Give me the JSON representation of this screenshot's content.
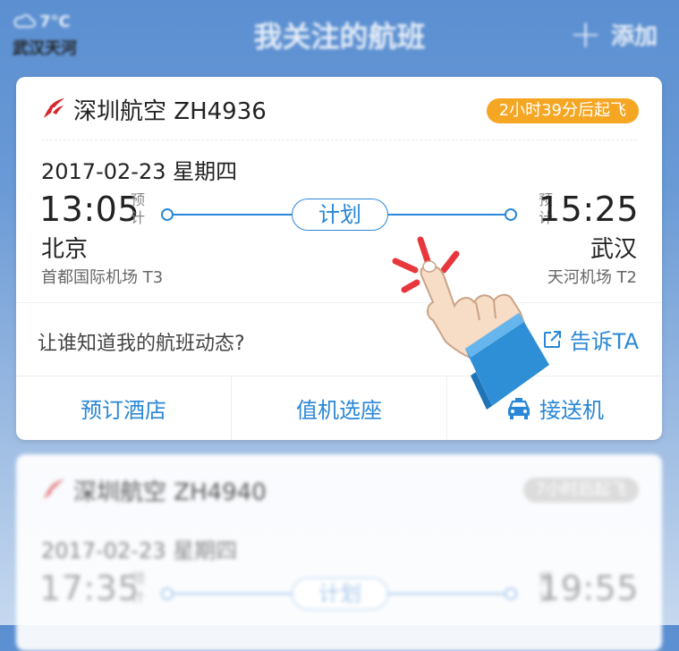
{
  "header": {
    "weather_temp": "7°C",
    "weather_city": "武汉天河",
    "title": "我关注的航班",
    "add_label": "添加"
  },
  "flights": [
    {
      "airline_flight": "深圳航空 ZH4936",
      "countdown": "2小时39分后起飞",
      "date": "2017-02-23 星期四",
      "dep_time": "13:05",
      "arr_time": "15:25",
      "est_label_dep": "预计",
      "est_label_arr": "预计",
      "status": "计划",
      "dep_city": "北京",
      "arr_city": "武汉",
      "dep_airport": "首都国际机场 T3",
      "arr_airport": "天河机场 T2"
    },
    {
      "airline_flight": "深圳航空 ZH4940",
      "countdown": "7小时后起飞",
      "date": "2017-02-23 星期四",
      "dep_time": "17:35",
      "arr_time": "19:55",
      "est_label_dep": "预计",
      "est_label_arr": "预计",
      "status": "计划"
    }
  ],
  "share": {
    "prompt": "让谁知道我的航班动态?",
    "tell_label": "告诉TA"
  },
  "actions": {
    "hotel": "预订酒店",
    "checkin": "值机选座",
    "transfer": "接送机"
  },
  "colors": {
    "accent": "#2a87d6",
    "countdown_bg": "#f5a623",
    "airline_red": "#d9262b",
    "header_bg": "#5b8fd1"
  },
  "icons": {
    "weather": "cloud-icon",
    "add": "plus-icon",
    "airline": "shenzhen-airlines-logo-icon",
    "share": "share-external-icon",
    "transfer": "car-icon",
    "pointer": "pointing-hand-icon"
  }
}
